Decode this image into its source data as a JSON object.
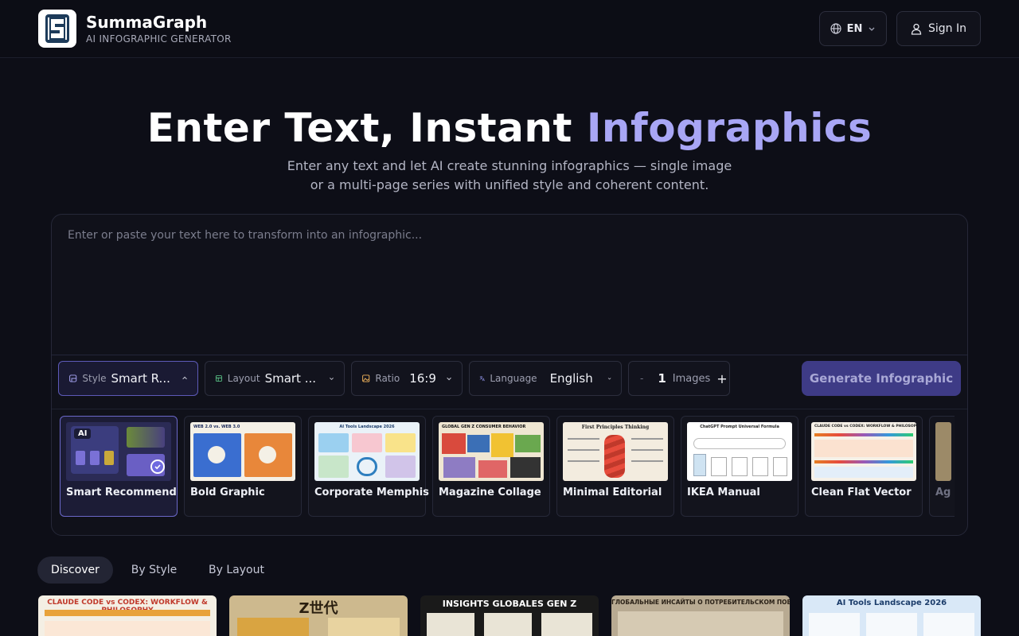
{
  "header": {
    "brand": "SummaGraph",
    "tagline": "AI INFOGRAPHIC GENERATOR",
    "lang": "EN",
    "signin": "Sign In"
  },
  "hero": {
    "title_main": "Enter Text, Instant ",
    "title_accent": "Infographics",
    "subtitle_line1": "Enter any text and let AI create stunning infographics — single image",
    "subtitle_line2": "or a multi-page series with unified style and coherent content."
  },
  "editor": {
    "placeholder": "Enter or paste your text here to transform into an infographic..."
  },
  "toolbar": {
    "style_label": "Style",
    "style_value": "Smart R...",
    "layout_label": "Layout",
    "layout_value": "Smart ...",
    "ratio_label": "Ratio",
    "ratio_value": "16:9",
    "language_label": "Language",
    "language_value": "English",
    "images_minus": "-",
    "images_count": "1",
    "images_label": "Images",
    "images_plus": "+",
    "generate": "Generate Infographic"
  },
  "styles": [
    {
      "name": "Smart Recommend",
      "thumb_text": "AI",
      "selected": true
    },
    {
      "name": "Bold Graphic",
      "thumb_text": "WEB 2.0 vs. WEB 3.0"
    },
    {
      "name": "Corporate Memphis",
      "thumb_text": "AI Tools Landscape 2026"
    },
    {
      "name": "Magazine Collage",
      "thumb_text": "GLOBAL GEN Z CONSUMER BEHAVIOR"
    },
    {
      "name": "Minimal Editorial",
      "thumb_text": "First Principles Thinking"
    },
    {
      "name": "IKEA Manual",
      "thumb_text": "ChatGPT Prompt Universal Formula"
    },
    {
      "name": "Clean Flat Vector",
      "thumb_text": "CLAUDE CODE vs CODEX: WORKFLOW & PHILOSOPHY"
    },
    {
      "name": "Ag",
      "thumb_text": ""
    }
  ],
  "tabs": [
    "Discover",
    "By Style",
    "By Layout"
  ],
  "gallery": [
    {
      "title": "CLAUDE CODE vs CODEX: WORKFLOW & PHILOSOPHY",
      "bg": "#f4efe4",
      "fg": "#c0392b"
    },
    {
      "title": "Z世代",
      "bg": "#cdb98e",
      "fg": "#2a1f10"
    },
    {
      "title": "INSIGHTS GLOBALES GEN Z",
      "bg": "#1a1a1a",
      "fg": "#ffffff"
    },
    {
      "title": "ГЛОБАЛЬНЫЕ ИНСАЙТЫ О ПОТРЕБИТЕЛЬСКОМ ПОВЕДЕНИИ GEN Z",
      "bg": "#b8aa92",
      "fg": "#2b2218"
    },
    {
      "title": "AI Tools Landscape 2026",
      "bg": "#d9e8f7",
      "fg": "#1c3d6b"
    }
  ]
}
